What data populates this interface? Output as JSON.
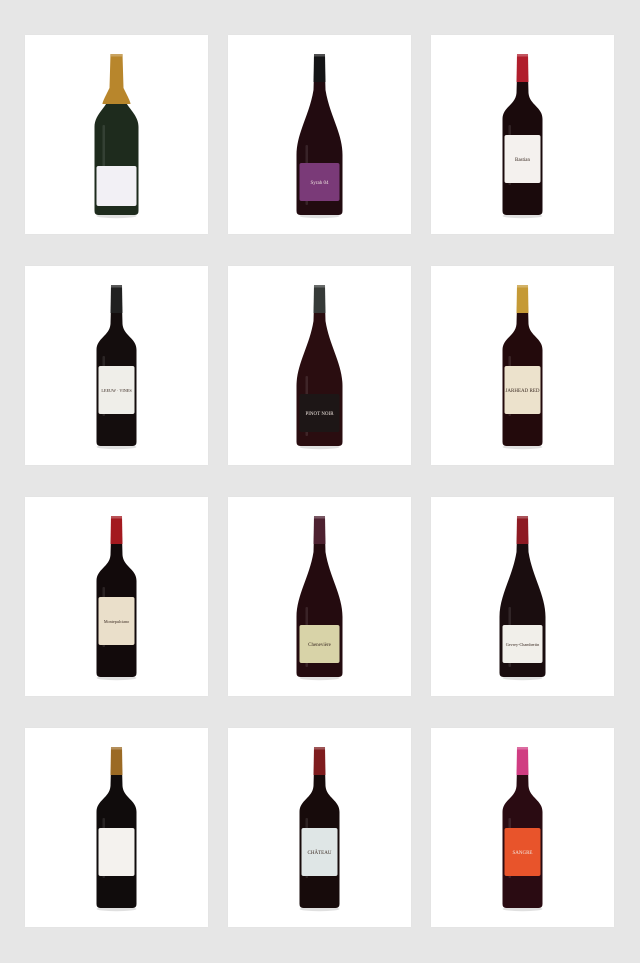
{
  "gallery": {
    "items": [
      {
        "name": "sparkling-wine-bottle",
        "style": "champagne",
        "foil": "#b8862c",
        "glass": "#1e2b1d",
        "label": "#f2f0f5",
        "label_text": ""
      },
      {
        "name": "pinot-bottle-purple-label",
        "style": "burgundy",
        "foil": "#141416",
        "glass": "#220b10",
        "label": "#7a3a78",
        "label_text": "Syrah 04"
      },
      {
        "name": "red-wine-kiss-label",
        "style": "bordeaux",
        "foil": "#b01e2c",
        "glass": "#1a0a0c",
        "label": "#f4f1ee",
        "label_text": "Bastian"
      },
      {
        "name": "leeuw-vines-bottle",
        "style": "bordeaux",
        "foil": "#202020",
        "glass": "#140d0d",
        "label": "#efeee9",
        "label_text": "LEEUW · VINES"
      },
      {
        "name": "dark-pinot-bottle",
        "style": "burgundy",
        "foil": "#363a38",
        "glass": "#2a0d10",
        "label": "#1d1616",
        "label_text": "PINOT NOIR"
      },
      {
        "name": "jarhead-red-bottle",
        "style": "bordeaux",
        "foil": "#c59a36",
        "glass": "#230a0c",
        "label": "#ece2cc",
        "label_text": "JARHEAD RED"
      },
      {
        "name": "montepulciano-bottle",
        "style": "bordeaux",
        "foil": "#a3191f",
        "glass": "#120a0b",
        "label": "#eadfca",
        "label_text": "Montepulciano"
      },
      {
        "name": "cheneviere-bottle",
        "style": "burgundy",
        "foil": "#4d2130",
        "glass": "#240b0f",
        "label": "#d8d3a8",
        "label_text": "Chenevière"
      },
      {
        "name": "gevrey-chambertin-bottle",
        "style": "burgundy",
        "foil": "#8e1a23",
        "glass": "#1a0d0f",
        "label": "#f1efea",
        "label_text": "Gevrey-Chambertin"
      },
      {
        "name": "white-label-star-bottle",
        "style": "bordeaux",
        "foil": "#9b6a24",
        "glass": "#100c0c",
        "label": "#f4f2ee",
        "label_text": ""
      },
      {
        "name": "chateau-label-bottle",
        "style": "bordeaux",
        "foil": "#7e1c1e",
        "glass": "#170b0b",
        "label": "#dfe6e6",
        "label_text": "CHÂTEAU"
      },
      {
        "name": "colorful-label-bottle",
        "style": "bordeaux",
        "foil": "#d03d82",
        "glass": "#2a0b12",
        "label": "#e8542b",
        "label_text": "SANGRE"
      }
    ]
  }
}
